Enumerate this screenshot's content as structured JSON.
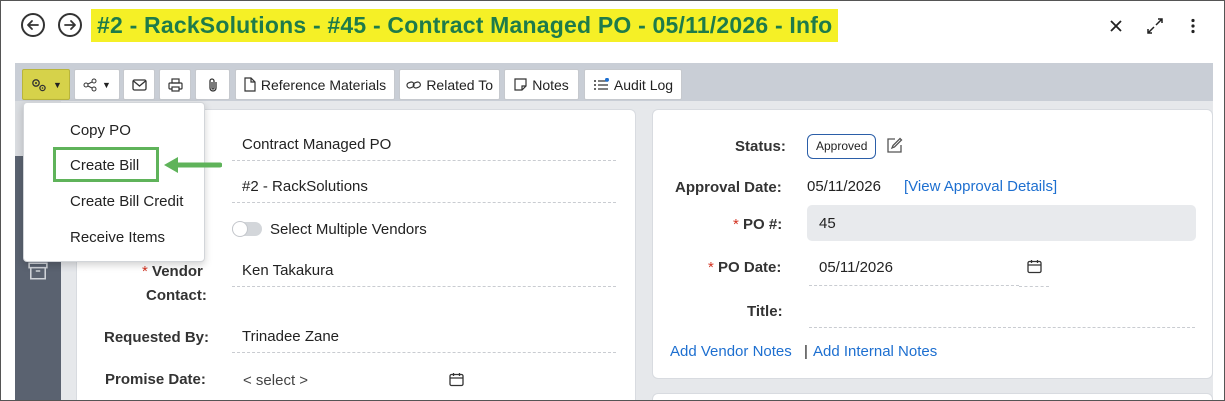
{
  "header": {
    "title": "#2 - RackSolutions - #45 - Contract Managed PO - 05/11/2026 - Info",
    "back_icon": "arrow-left-circle",
    "forward_icon": "arrow-right-circle",
    "close_icon": "close",
    "expand_icon": "expand",
    "more_icon": "more-vertical"
  },
  "toolbar": {
    "actions_icon": "gears",
    "share_icon": "share",
    "email_icon": "envelope",
    "print_icon": "printer",
    "attach_icon": "paperclip",
    "reference_materials": "Reference Materials",
    "related_to": "Related To",
    "notes": "Notes",
    "audit_log": "Audit Log"
  },
  "actions_menu": {
    "items": [
      "Copy PO",
      "Create Bill",
      "Create Bill Credit",
      "Receive Items"
    ],
    "highlighted": "Create Bill",
    "highlight_color": "#5fb35a"
  },
  "left_form": {
    "field1_value": "Contract Managed PO",
    "field2_value": "#2 - RackSolutions",
    "multi_vendor_label": "Select Multiple Vendors",
    "vendor_contact_label_1": "Vendor",
    "vendor_contact_label_2": "Contact:",
    "vendor_contact_value": "Ken Takakura",
    "requested_by_label": "Requested By:",
    "requested_by_value": "Trinadee Zane",
    "promise_date_label": "Promise Date:",
    "promise_date_placeholder": "< select >"
  },
  "right_form": {
    "status_label": "Status:",
    "status_value": "Approved",
    "approval_date_label": "Approval Date:",
    "approval_date_value": "05/11/2026",
    "view_approval_link": "[View Approval Details]",
    "po_number_label": "PO #:",
    "po_number_value": "45",
    "po_date_label": "PO Date:",
    "po_date_value": "05/11/2026",
    "title_label": "Title:",
    "title_value": "",
    "add_vendor_notes": "Add Vendor Notes",
    "separator": "|",
    "add_internal_notes": "Add Internal Notes"
  },
  "colors": {
    "title_highlight": "#f5f026",
    "title_text": "#1e7b4a",
    "active_button": "#d6d24a",
    "link": "#1d6fd0",
    "required": "#d2301f"
  }
}
